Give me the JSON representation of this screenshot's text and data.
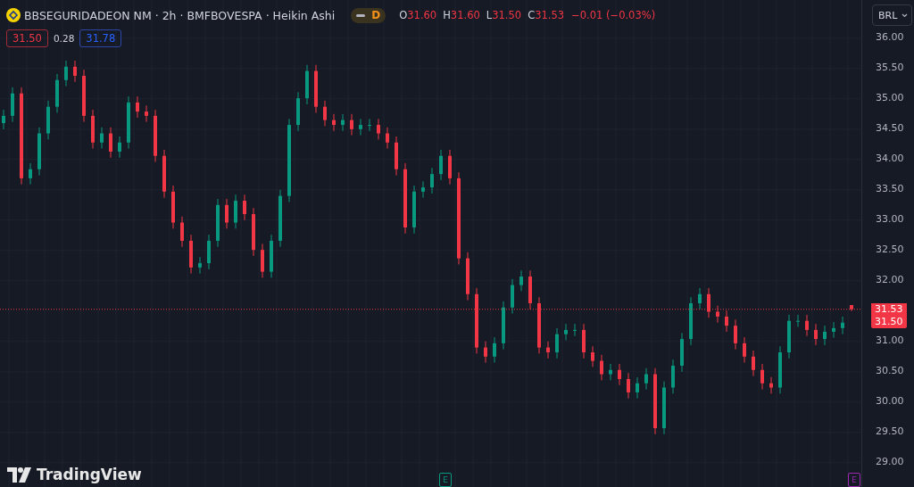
{
  "header": {
    "symbol": "BBSEGURIDADEON NM · 2h · BMFBOVESPA · Heikin Ashi",
    "market_status": "D",
    "ohlc": [
      {
        "label": "O",
        "value": "31.60"
      },
      {
        "label": "H",
        "value": "31.60"
      },
      {
        "label": "L",
        "value": "31.50"
      },
      {
        "label": "C",
        "value": "31.53"
      }
    ],
    "change": "−0.01 (−0.03%)"
  },
  "quote": {
    "bid": "31.50",
    "spread": "0.28",
    "ask": "31.78"
  },
  "currency": "BRL",
  "chart": {
    "chart_data": {
      "type": "candlestick",
      "grid": true,
      "ylim": [
        28.6,
        36.63
      ],
      "ref_lines": [
        {
          "value": 31.53,
          "axis": "y",
          "color": "#f23645",
          "label": "31.53"
        }
      ],
      "yticks": [
        {
          "value": 36,
          "label": "36.00"
        },
        {
          "value": 35.5,
          "label": "35.50"
        },
        {
          "value": 35,
          "label": "35.00"
        },
        {
          "value": 34.5,
          "label": "34.50"
        },
        {
          "value": 34,
          "label": "34.00"
        },
        {
          "value": 33.5,
          "label": "33.50"
        },
        {
          "value": 33,
          "label": "33.00"
        },
        {
          "value": 32.5,
          "label": "32.50"
        },
        {
          "value": 32,
          "label": "32.00"
        },
        {
          "value": 31,
          "label": "31.00"
        },
        {
          "value": 30.5,
          "label": "30.50"
        },
        {
          "value": 30,
          "label": "30.00"
        },
        {
          "value": 29.5,
          "label": "29.50"
        },
        {
          "value": 29,
          "label": "29.00"
        }
      ],
      "ohlc": [
        [
          34.6,
          34.82,
          34.5,
          34.72
        ],
        [
          34.72,
          35.19,
          34.62,
          35.09
        ],
        [
          35.09,
          35.19,
          33.59,
          33.69
        ],
        [
          33.69,
          33.94,
          33.59,
          33.84
        ],
        [
          33.84,
          34.53,
          33.74,
          34.43
        ],
        [
          34.43,
          34.97,
          34.33,
          34.87
        ],
        [
          34.87,
          35.41,
          34.77,
          35.31
        ],
        [
          35.31,
          35.63,
          35.21,
          35.53
        ],
        [
          35.53,
          35.63,
          35.28,
          35.38
        ],
        [
          35.38,
          35.48,
          34.62,
          34.72
        ],
        [
          34.72,
          34.82,
          34.18,
          34.28
        ],
        [
          34.28,
          34.53,
          34.18,
          34.43
        ],
        [
          34.43,
          34.53,
          34.03,
          34.13
        ],
        [
          34.13,
          34.38,
          34.03,
          34.28
        ],
        [
          34.28,
          35.04,
          34.18,
          34.94
        ],
        [
          34.94,
          35.04,
          34.69,
          34.79
        ],
        [
          34.79,
          34.89,
          34.62,
          34.72
        ],
        [
          34.72,
          34.82,
          33.96,
          34.06
        ],
        [
          34.06,
          34.16,
          33.37,
          33.47
        ],
        [
          33.47,
          33.57,
          32.86,
          32.96
        ],
        [
          32.96,
          33.06,
          32.56,
          32.66
        ],
        [
          32.66,
          32.76,
          32.12,
          32.22
        ],
        [
          32.22,
          32.39,
          32.12,
          32.29
        ],
        [
          32.29,
          32.76,
          32.19,
          32.66
        ],
        [
          32.66,
          33.35,
          32.56,
          33.25
        ],
        [
          33.25,
          33.35,
          32.86,
          32.96
        ],
        [
          32.96,
          33.42,
          32.86,
          33.32
        ],
        [
          33.32,
          33.42,
          33.0,
          33.1
        ],
        [
          33.1,
          33.2,
          32.41,
          32.51
        ],
        [
          32.51,
          32.61,
          32.05,
          32.15
        ],
        [
          32.15,
          32.76,
          32.05,
          32.66
        ],
        [
          32.66,
          33.5,
          32.56,
          33.4
        ],
        [
          33.4,
          34.67,
          33.3,
          34.57
        ],
        [
          34.57,
          35.11,
          34.47,
          35.01
        ],
        [
          35.01,
          35.56,
          34.91,
          35.46
        ],
        [
          35.46,
          35.56,
          34.77,
          34.87
        ],
        [
          34.87,
          34.97,
          34.55,
          34.65
        ],
        [
          34.65,
          34.75,
          34.47,
          34.57
        ],
        [
          34.57,
          34.75,
          34.47,
          34.65
        ],
        [
          34.65,
          34.75,
          34.4,
          34.5
        ],
        [
          34.5,
          34.67,
          34.4,
          34.57
        ],
        [
          34.57,
          34.67,
          34.47,
          34.57
        ],
        [
          34.57,
          34.67,
          34.33,
          34.43
        ],
        [
          34.43,
          34.53,
          34.18,
          34.28
        ],
        [
          34.28,
          34.38,
          33.74,
          33.84
        ],
        [
          33.84,
          33.94,
          32.78,
          32.88
        ],
        [
          32.88,
          33.57,
          32.78,
          33.47
        ],
        [
          33.47,
          33.64,
          33.37,
          33.54
        ],
        [
          33.54,
          33.86,
          33.44,
          33.76
        ],
        [
          33.76,
          34.16,
          33.66,
          34.06
        ],
        [
          34.06,
          34.16,
          33.59,
          33.69
        ],
        [
          33.69,
          33.79,
          32.27,
          32.37
        ],
        [
          32.37,
          32.47,
          31.68,
          31.78
        ],
        [
          31.78,
          31.88,
          30.8,
          30.9
        ],
        [
          30.9,
          31.0,
          30.65,
          30.75
        ],
        [
          30.75,
          31.07,
          30.65,
          30.97
        ],
        [
          30.97,
          31.66,
          30.87,
          31.56
        ],
        [
          31.56,
          32.03,
          31.46,
          31.93
        ],
        [
          31.93,
          32.17,
          31.83,
          32.07
        ],
        [
          32.07,
          32.17,
          31.53,
          31.63
        ],
        [
          31.63,
          31.73,
          30.8,
          30.9
        ],
        [
          30.9,
          31.0,
          30.72,
          30.82
        ],
        [
          30.82,
          31.22,
          30.72,
          31.12
        ],
        [
          31.12,
          31.29,
          31.02,
          31.19
        ],
        [
          31.19,
          31.29,
          31.09,
          31.19
        ],
        [
          31.19,
          31.29,
          30.72,
          30.82
        ],
        [
          30.82,
          30.92,
          30.58,
          30.68
        ],
        [
          30.68,
          30.78,
          30.36,
          30.46
        ],
        [
          30.46,
          30.63,
          30.36,
          30.53
        ],
        [
          30.53,
          30.63,
          30.28,
          30.38
        ],
        [
          30.38,
          30.48,
          30.06,
          30.16
        ],
        [
          30.16,
          30.41,
          30.06,
          30.31
        ],
        [
          30.31,
          30.56,
          30.21,
          30.46
        ],
        [
          30.46,
          30.56,
          29.47,
          29.57
        ],
        [
          29.57,
          30.34,
          29.47,
          30.24
        ],
        [
          30.24,
          30.7,
          30.14,
          30.6
        ],
        [
          30.6,
          31.14,
          30.5,
          31.04
        ],
        [
          31.04,
          31.73,
          30.94,
          31.63
        ],
        [
          31.63,
          31.88,
          31.53,
          31.78
        ],
        [
          31.78,
          31.88,
          31.39,
          31.49
        ],
        [
          31.49,
          31.59,
          31.31,
          31.41
        ],
        [
          31.41,
          31.51,
          31.16,
          31.26
        ],
        [
          31.26,
          31.36,
          30.87,
          30.97
        ],
        [
          30.97,
          31.07,
          30.65,
          30.75
        ],
        [
          30.75,
          30.85,
          30.43,
          30.53
        ],
        [
          30.53,
          30.63,
          30.21,
          30.31
        ],
        [
          30.31,
          30.41,
          30.14,
          30.24
        ],
        [
          30.24,
          30.92,
          30.14,
          30.82
        ],
        [
          30.82,
          31.44,
          30.72,
          31.34
        ],
        [
          31.34,
          31.44,
          31.24,
          31.34
        ],
        [
          31.34,
          31.44,
          31.09,
          31.19
        ],
        [
          31.19,
          31.29,
          30.94,
          31.04
        ],
        [
          31.04,
          31.26,
          30.94,
          31.16
        ],
        [
          31.16,
          31.32,
          31.06,
          31.22
        ],
        [
          31.22,
          31.41,
          31.12,
          31.31
        ],
        [
          31.6,
          31.6,
          31.5,
          31.53
        ]
      ]
    },
    "price_tags": [
      "31.50"
    ]
  },
  "events": [
    {
      "label": "E",
      "color": "#089981"
    },
    {
      "label": "E",
      "color": "#9c27b0"
    }
  ],
  "brand": "TradingView"
}
